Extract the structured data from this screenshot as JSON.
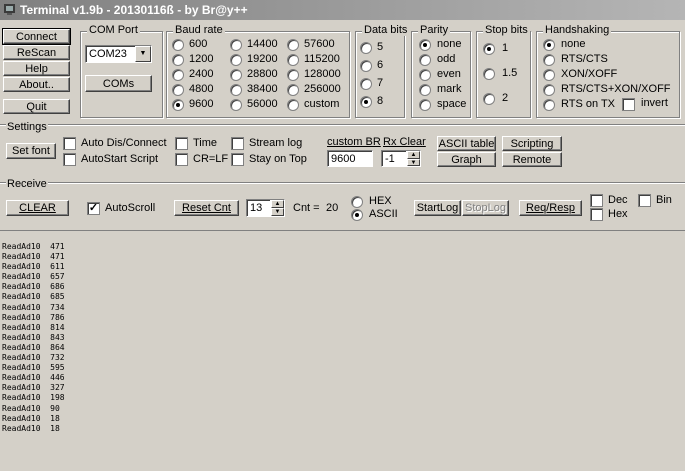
{
  "window": {
    "title": "Terminal v1.9b - 20130116ß - by Br@y++"
  },
  "left_buttons": {
    "connect": "Connect",
    "rescan": "ReScan",
    "help": "Help",
    "about": "About..",
    "quit": "Quit"
  },
  "com_port": {
    "group_label": "COM Port",
    "selected": "COM23",
    "coms_button": "COMs"
  },
  "baud_rate": {
    "group_label": "Baud rate",
    "options": [
      "600",
      "1200",
      "2400",
      "4800",
      "9600",
      "14400",
      "19200",
      "28800",
      "38400",
      "56000",
      "57600",
      "115200",
      "128000",
      "256000",
      "custom"
    ],
    "selected": "9600"
  },
  "data_bits": {
    "group_label": "Data bits",
    "options": [
      "5",
      "6",
      "7",
      "8"
    ],
    "selected": "8"
  },
  "parity": {
    "group_label": "Parity",
    "options": [
      "none",
      "odd",
      "even",
      "mark",
      "space"
    ],
    "selected": "none"
  },
  "stop_bits": {
    "group_label": "Stop bits",
    "options": [
      "1",
      "1.5",
      "2"
    ],
    "selected": "1"
  },
  "handshaking": {
    "group_label": "Handshaking",
    "options": [
      "none",
      "RTS/CTS",
      "XON/XOFF",
      "RTS/CTS+XON/XOFF",
      "RTS on TX"
    ],
    "selected": "none",
    "invert_label": "invert"
  },
  "settings": {
    "group_label": "Settings",
    "set_font": "Set font",
    "auto_dis_connect": "Auto Dis/Connect",
    "autostart_script": "AutoStart Script",
    "time": "Time",
    "cr_lf": "CR=LF",
    "stream_log": "Stream log",
    "stay_on_top": "Stay on Top",
    "custom_br_label": "custom BR",
    "custom_br_value": "9600",
    "rx_clear_label": "Rx Clear",
    "rx_clear_value": "-1",
    "ascii_table": "ASCII table",
    "graph": "Graph",
    "scripting": "Scripting",
    "remote": "Remote"
  },
  "receive": {
    "group_label": "Receive",
    "clear": "CLEAR",
    "autoscroll": "AutoScroll",
    "autoscroll_checked": true,
    "reset_cnt": "Reset Cnt",
    "reset_value": "13",
    "cnt_label": "Cnt =",
    "cnt_value": "20",
    "hex": "HEX",
    "ascii": "ASCII",
    "display_selected": "ASCII",
    "startlog": "StartLog",
    "stoplog": "StopLog",
    "req_resp": "Req/Resp",
    "dec": "Dec",
    "hex_check": "Hex",
    "bin": "Bin"
  },
  "receive_lines": [
    "ReadAd10  471",
    "ReadAd10  471",
    "ReadAd10  611",
    "ReadAd10  657",
    "ReadAd10  686",
    "ReadAd10  685",
    "ReadAd10  734",
    "ReadAd10  786",
    "ReadAd10  814",
    "ReadAd10  843",
    "ReadAd10  864",
    "ReadAd10  732",
    "ReadAd10  595",
    "ReadAd10  446",
    "ReadAd10  327",
    "ReadAd10  198",
    "ReadAd10  90",
    "ReadAd10  18",
    "ReadAd10  18"
  ]
}
